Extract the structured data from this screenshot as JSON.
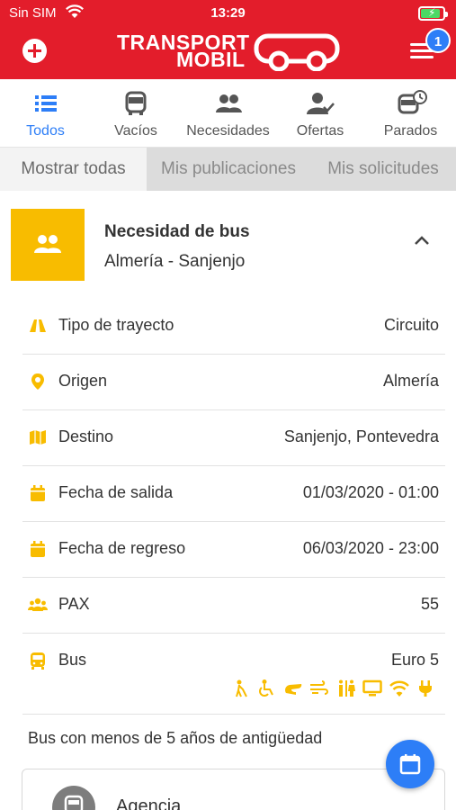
{
  "status_bar": {
    "carrier": "Sin SIM",
    "time": "13:29",
    "icons": [
      "wifi-icon",
      "battery-charging-icon"
    ]
  },
  "header": {
    "logo_line1": "TRANSPORT",
    "logo_line2": "MOBIL",
    "notification_count": "1",
    "brand_color": "#e31d2b",
    "icons": [
      "add-icon",
      "hamburger-menu-icon",
      "bus-outline-icon"
    ]
  },
  "categories": [
    {
      "label": "Todos",
      "icon": "list-icon",
      "active": true
    },
    {
      "label": "Vacíos",
      "icon": "bus-icon",
      "active": false
    },
    {
      "label": "Necesidades",
      "icon": "users-icon",
      "active": false
    },
    {
      "label": "Ofertas",
      "icon": "user-check-icon",
      "active": false
    },
    {
      "label": "Parados",
      "icon": "bus-clock-icon",
      "active": false
    }
  ],
  "filters": [
    {
      "label": "Mostrar todas",
      "active": true
    },
    {
      "label": "Mis publicaciones",
      "active": false
    },
    {
      "label": "Mis solicitudes",
      "active": false
    }
  ],
  "card": {
    "title": "Necesidad de bus",
    "route": "Almería - Sanjenjo",
    "accent_color": "#f8bc00",
    "rows": [
      {
        "icon": "road-icon",
        "label": "Tipo de trayecto",
        "value": "Circuito"
      },
      {
        "icon": "map-pin-icon",
        "label": "Origen",
        "value": "Almería"
      },
      {
        "icon": "map-icon",
        "label": "Destino",
        "value": "Sanjenjo, Pontevedra"
      },
      {
        "icon": "calendar-icon",
        "label": "Fecha de salida",
        "value": "01/03/2020 - 01:00"
      },
      {
        "icon": "calendar-icon",
        "label": "Fecha de regreso",
        "value": "06/03/2020 - 23:00"
      },
      {
        "icon": "group-icon",
        "label": "PAX",
        "value": "55"
      },
      {
        "icon": "bus-front-icon",
        "label": "Bus",
        "value": "Euro 5"
      }
    ],
    "bus_features": [
      "blind-icon",
      "wheelchair-icon",
      "reclining-seat-icon",
      "air-conditioning-icon",
      "toilet-icon",
      "tv-icon",
      "wifi-icon",
      "plug-icon"
    ],
    "note": "Bus con menos de 5 años de antigüedad",
    "agency_label": "Agencia"
  },
  "fab": {
    "icon": "calendar-icon"
  },
  "accent_blue": "#2d7ef7"
}
